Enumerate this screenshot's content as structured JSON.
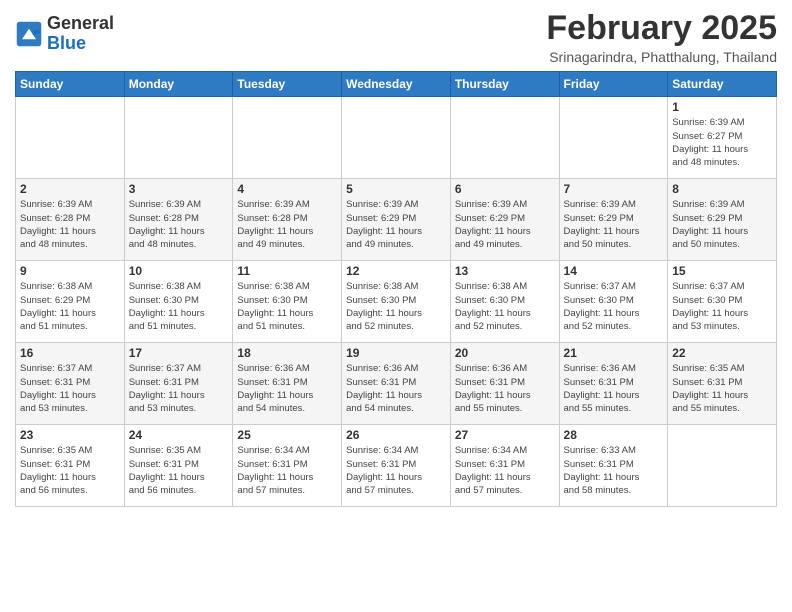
{
  "header": {
    "logo_general": "General",
    "logo_blue": "Blue",
    "month_title": "February 2025",
    "location": "Srinagarindra, Phatthalung, Thailand"
  },
  "weekdays": [
    "Sunday",
    "Monday",
    "Tuesday",
    "Wednesday",
    "Thursday",
    "Friday",
    "Saturday"
  ],
  "weeks": [
    [
      {
        "day": "",
        "info": ""
      },
      {
        "day": "",
        "info": ""
      },
      {
        "day": "",
        "info": ""
      },
      {
        "day": "",
        "info": ""
      },
      {
        "day": "",
        "info": ""
      },
      {
        "day": "",
        "info": ""
      },
      {
        "day": "1",
        "info": "Sunrise: 6:39 AM\nSunset: 6:27 PM\nDaylight: 11 hours\nand 48 minutes."
      }
    ],
    [
      {
        "day": "2",
        "info": "Sunrise: 6:39 AM\nSunset: 6:28 PM\nDaylight: 11 hours\nand 48 minutes."
      },
      {
        "day": "3",
        "info": "Sunrise: 6:39 AM\nSunset: 6:28 PM\nDaylight: 11 hours\nand 48 minutes."
      },
      {
        "day": "4",
        "info": "Sunrise: 6:39 AM\nSunset: 6:28 PM\nDaylight: 11 hours\nand 49 minutes."
      },
      {
        "day": "5",
        "info": "Sunrise: 6:39 AM\nSunset: 6:29 PM\nDaylight: 11 hours\nand 49 minutes."
      },
      {
        "day": "6",
        "info": "Sunrise: 6:39 AM\nSunset: 6:29 PM\nDaylight: 11 hours\nand 49 minutes."
      },
      {
        "day": "7",
        "info": "Sunrise: 6:39 AM\nSunset: 6:29 PM\nDaylight: 11 hours\nand 50 minutes."
      },
      {
        "day": "8",
        "info": "Sunrise: 6:39 AM\nSunset: 6:29 PM\nDaylight: 11 hours\nand 50 minutes."
      }
    ],
    [
      {
        "day": "9",
        "info": "Sunrise: 6:38 AM\nSunset: 6:29 PM\nDaylight: 11 hours\nand 51 minutes."
      },
      {
        "day": "10",
        "info": "Sunrise: 6:38 AM\nSunset: 6:30 PM\nDaylight: 11 hours\nand 51 minutes."
      },
      {
        "day": "11",
        "info": "Sunrise: 6:38 AM\nSunset: 6:30 PM\nDaylight: 11 hours\nand 51 minutes."
      },
      {
        "day": "12",
        "info": "Sunrise: 6:38 AM\nSunset: 6:30 PM\nDaylight: 11 hours\nand 52 minutes."
      },
      {
        "day": "13",
        "info": "Sunrise: 6:38 AM\nSunset: 6:30 PM\nDaylight: 11 hours\nand 52 minutes."
      },
      {
        "day": "14",
        "info": "Sunrise: 6:37 AM\nSunset: 6:30 PM\nDaylight: 11 hours\nand 52 minutes."
      },
      {
        "day": "15",
        "info": "Sunrise: 6:37 AM\nSunset: 6:30 PM\nDaylight: 11 hours\nand 53 minutes."
      }
    ],
    [
      {
        "day": "16",
        "info": "Sunrise: 6:37 AM\nSunset: 6:31 PM\nDaylight: 11 hours\nand 53 minutes."
      },
      {
        "day": "17",
        "info": "Sunrise: 6:37 AM\nSunset: 6:31 PM\nDaylight: 11 hours\nand 53 minutes."
      },
      {
        "day": "18",
        "info": "Sunrise: 6:36 AM\nSunset: 6:31 PM\nDaylight: 11 hours\nand 54 minutes."
      },
      {
        "day": "19",
        "info": "Sunrise: 6:36 AM\nSunset: 6:31 PM\nDaylight: 11 hours\nand 54 minutes."
      },
      {
        "day": "20",
        "info": "Sunrise: 6:36 AM\nSunset: 6:31 PM\nDaylight: 11 hours\nand 55 minutes."
      },
      {
        "day": "21",
        "info": "Sunrise: 6:36 AM\nSunset: 6:31 PM\nDaylight: 11 hours\nand 55 minutes."
      },
      {
        "day": "22",
        "info": "Sunrise: 6:35 AM\nSunset: 6:31 PM\nDaylight: 11 hours\nand 55 minutes."
      }
    ],
    [
      {
        "day": "23",
        "info": "Sunrise: 6:35 AM\nSunset: 6:31 PM\nDaylight: 11 hours\nand 56 minutes."
      },
      {
        "day": "24",
        "info": "Sunrise: 6:35 AM\nSunset: 6:31 PM\nDaylight: 11 hours\nand 56 minutes."
      },
      {
        "day": "25",
        "info": "Sunrise: 6:34 AM\nSunset: 6:31 PM\nDaylight: 11 hours\nand 57 minutes."
      },
      {
        "day": "26",
        "info": "Sunrise: 6:34 AM\nSunset: 6:31 PM\nDaylight: 11 hours\nand 57 minutes."
      },
      {
        "day": "27",
        "info": "Sunrise: 6:34 AM\nSunset: 6:31 PM\nDaylight: 11 hours\nand 57 minutes."
      },
      {
        "day": "28",
        "info": "Sunrise: 6:33 AM\nSunset: 6:31 PM\nDaylight: 11 hours\nand 58 minutes."
      },
      {
        "day": "",
        "info": ""
      }
    ]
  ]
}
